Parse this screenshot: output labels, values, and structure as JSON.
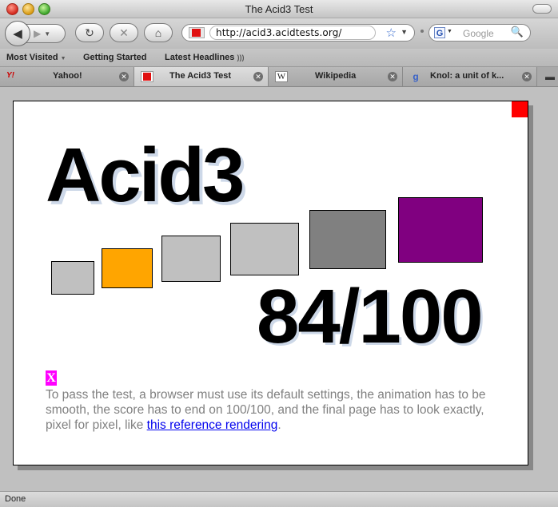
{
  "window": {
    "title": "The Acid3 Test"
  },
  "nav": {
    "back_icon": "back-arrow-icon",
    "forward_icon": "forward-arrow-icon",
    "reload_icon": "reload-icon",
    "stop_icon": "stop-icon",
    "home_icon": "home-icon",
    "url": "http://acid3.acidtests.org/",
    "search_placeholder": "Google"
  },
  "bookmarks": {
    "items": [
      "Most Visited",
      "Getting Started",
      "Latest Headlines"
    ]
  },
  "tabs": [
    {
      "label": "Yahoo!",
      "active": false
    },
    {
      "label": "The Acid3 Test",
      "active": true
    },
    {
      "label": "Wikipedia",
      "active": false
    },
    {
      "label": "Knol: a unit of k...",
      "active": false
    }
  ],
  "page": {
    "title": "Acid3",
    "score": "84/100",
    "x_mark": "X",
    "description_before": "To pass the test, a browser must use its default settings, the animation has to be smooth, the score has to end on 100/100, and the final page has to look exactly, pixel for pixel, like ",
    "link_text": "this reference rendering",
    "description_after": ".",
    "box_colors": [
      "#c0c0c0",
      "#ffa500",
      "#c0c0c0",
      "#c0c0c0",
      "#808080",
      "#800080"
    ],
    "corner_color": "#ff0000"
  },
  "status": {
    "text": "Done"
  }
}
